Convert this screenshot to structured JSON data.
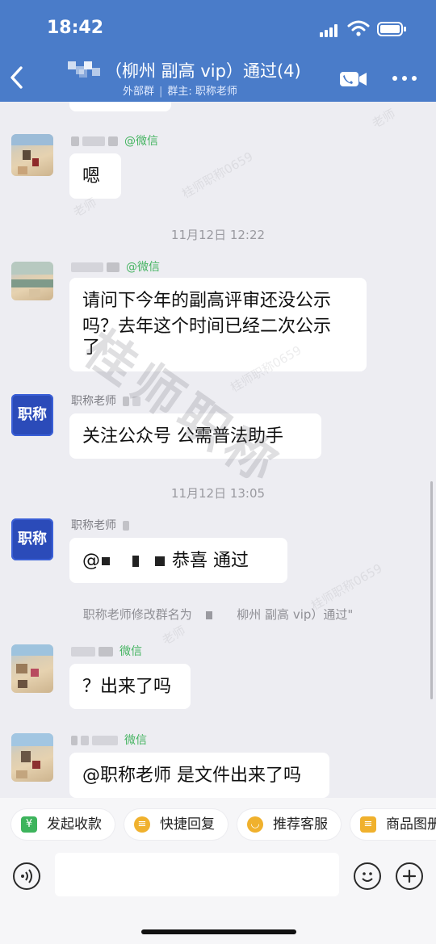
{
  "status_bar": {
    "time": "18:42"
  },
  "header": {
    "title": "（柳州 副高 vip）通过(4)",
    "group_type": "外部群",
    "owner": "群主: 职称老师"
  },
  "messages": [
    {
      "sender_suffix": "@微信",
      "text": "嗯"
    },
    {
      "timestamp": "11月12日 12:22"
    },
    {
      "sender_suffix": "@微信",
      "lines": [
        "请问下今年的副高评审还没公示",
        "吗？去年这个时间已经二次公示",
        "了"
      ]
    },
    {
      "avatar_text": "职称",
      "sender": "职称老师",
      "text": "关注公众号  公需普法助手"
    },
    {
      "timestamp": "11月12日 13:05"
    },
    {
      "avatar_text": "职称",
      "sender": "职称老师",
      "mention": "@",
      "text": "恭喜  通过"
    },
    {
      "system": "职称老师修改群名为",
      "system_tail": "柳州 副高 vip）通过\""
    },
    {
      "sender_suffix": "微信",
      "text": "？出来了吗"
    },
    {
      "sender_suffix": "微信",
      "text": "@职称老师 是文件出来了吗"
    }
  ],
  "watermark": {
    "small": "桂师职称0659",
    "big": "桂师职称",
    "prefix": "老师"
  },
  "quick_replies": [
    {
      "label": "发起收款",
      "icon": "yen-icon",
      "color": "#3db45c",
      "glyph": "¥"
    },
    {
      "label": "快捷回复",
      "icon": "quick-reply-icon",
      "color": "#f0b12d",
      "glyph": "≡"
    },
    {
      "label": "推荐客服",
      "icon": "recommend-icon",
      "color": "#f0b12d",
      "glyph": "◡"
    },
    {
      "label": "商品图册",
      "icon": "catalog-icon",
      "color": "#f0b12d",
      "glyph": "≡"
    }
  ],
  "colors": {
    "header": "#4a7cc9",
    "wechat_tag": "#45b461",
    "avatar_logo": "#2b4bb9"
  }
}
